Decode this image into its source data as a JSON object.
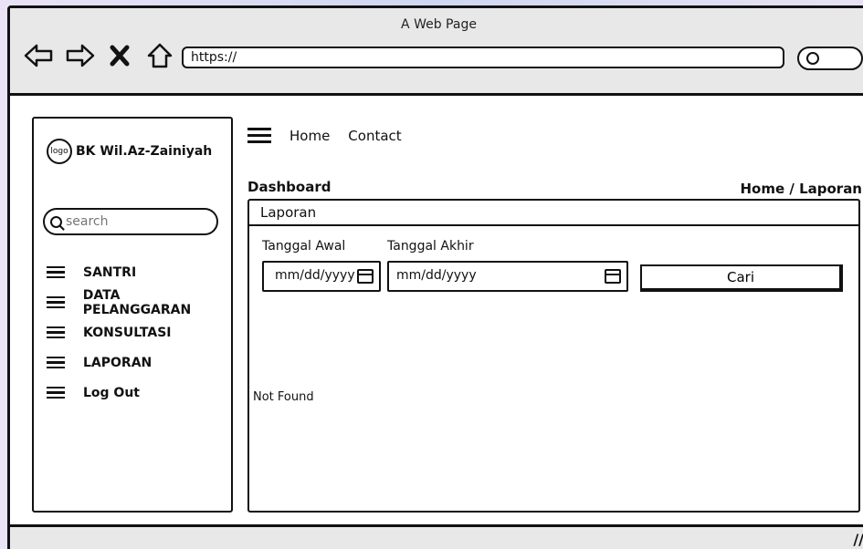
{
  "window": {
    "title": "A Web Page"
  },
  "browser": {
    "url": "https://",
    "nav": {
      "back": "back-icon",
      "forward": "forward-icon",
      "stop": "close-icon",
      "home": "home-icon"
    }
  },
  "sidebar": {
    "logo_text": "logo",
    "brand": "BK Wil.Az-Zainiyah",
    "search_placeholder": "search",
    "items": [
      {
        "label": "SANTRI"
      },
      {
        "label": "DATA PELANGGARAN"
      },
      {
        "label": "KONSULTASI"
      },
      {
        "label": "LAPORAN"
      },
      {
        "label": "Log Out"
      }
    ]
  },
  "topnav": {
    "home": "Home",
    "contact": "Contact"
  },
  "page": {
    "title": "Dashboard",
    "breadcrumb": "Home / Laporan",
    "panel_title": "Laporan",
    "filters": {
      "start_label": "Tanggal Awal",
      "end_label": "Tanggal Akhir",
      "start_placeholder": "mm/dd/yyyy",
      "end_placeholder": "mm/dd/yyyy",
      "button": "Cari"
    },
    "result": "Not Found"
  }
}
